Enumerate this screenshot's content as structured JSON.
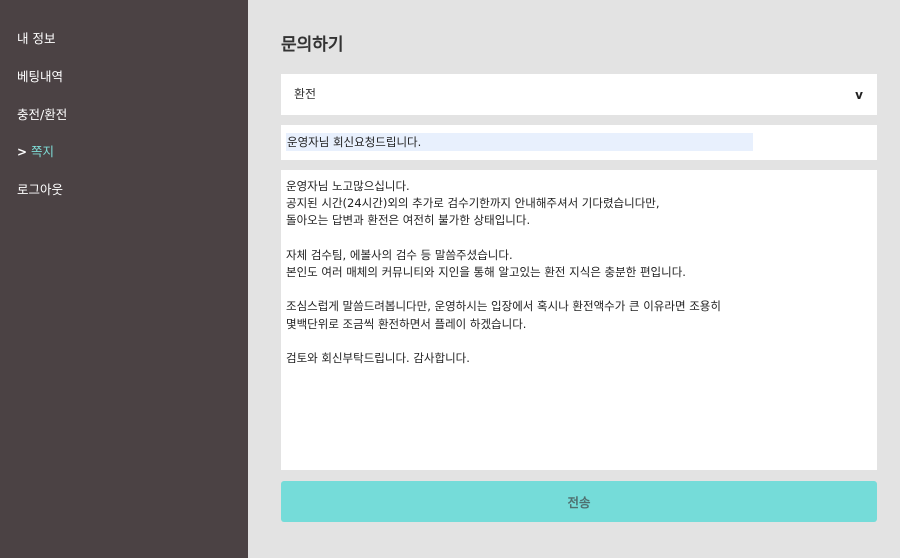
{
  "sidebar": {
    "items": [
      {
        "label": "내 정보",
        "active": false
      },
      {
        "label": "베팅내역",
        "active": false
      },
      {
        "label": "충전/환전",
        "active": false
      },
      {
        "label": "쪽지",
        "active": true
      },
      {
        "label": "로그아웃",
        "active": false
      }
    ],
    "active_marker": ">"
  },
  "main": {
    "title": "문의하기",
    "category_select": {
      "value": "환전",
      "chevron": "v"
    },
    "subject": {
      "value": "운영자님 회신요청드립니다."
    },
    "message": {
      "value": "운영자님 노고많으십니다.\n공지된 시간(24시간)외의 추가로 검수기한까지 안내해주셔서 기다렸습니다만,\n돌아오는 답변과 환전은 여전히 불가한 상태입니다.\n\n자체 검수팀, 에볼사의 검수 등 말씀주셨습니다.\n본인도 여러 매체의 커뮤니티와 지인을 통해 알고있는 환전 지식은 충분한 편입니다.\n\n조심스럽게 말씀드려봅니다만, 운영하시는 입장에서 혹시나 환전액수가 큰 이유라면 조용히\n몇백단위로 조금씩 환전하면서 플레이 하겠습니다.\n\n검토와 회신부탁드립니다. 감사합니다."
    },
    "send_label": "전송"
  },
  "colors": {
    "sidebar_bg": "#4b4244",
    "content_bg": "#e3e3e3",
    "accent": "#75dcd9",
    "active_nav": "#7fdcd6"
  }
}
